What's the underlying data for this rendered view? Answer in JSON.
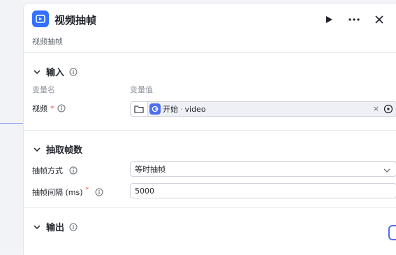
{
  "panel": {
    "title": "视频抽帧",
    "subtitle": "视频抽帧"
  },
  "input_section": {
    "title": "输入",
    "col_name": "变量名",
    "col_value": "变量值",
    "field_label": "视频",
    "required_mark": "*",
    "ref_node": "开始",
    "ref_sep": "·",
    "ref_var": "video",
    "clear_glyph": "×"
  },
  "extract_section": {
    "title": "抽取帧数",
    "method_label": "抽帧方式",
    "method_value": "等时抽帧",
    "interval_label": "抽帧间隔 (ms)",
    "interval_required": "*",
    "interval_value": "5000"
  },
  "output_section": {
    "title": "输出"
  },
  "colors": {
    "accent": "#3370ff",
    "required": "#f54a45"
  }
}
